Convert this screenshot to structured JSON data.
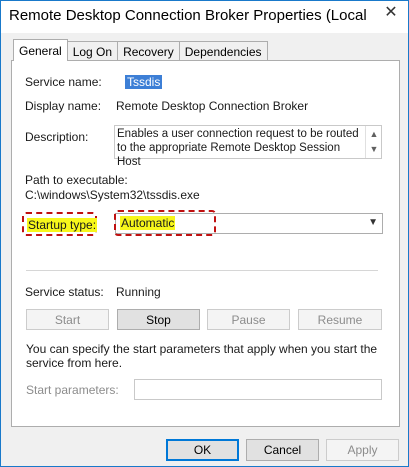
{
  "window": {
    "title": "Remote Desktop Connection Broker Properties (Local Computer)",
    "close_glyph": "✕"
  },
  "tabs": [
    {
      "label": "General",
      "active": true
    },
    {
      "label": "Log On",
      "active": false
    },
    {
      "label": "Recovery",
      "active": false
    },
    {
      "label": "Dependencies",
      "active": false
    }
  ],
  "general": {
    "service_name_label": "Service name:",
    "service_name_value": "Tssdis",
    "display_name_label": "Display name:",
    "display_name_value": "Remote Desktop Connection Broker",
    "description_label": "Description:",
    "description_value": "Enables a user connection request to be routed to the appropriate Remote Desktop Session Host",
    "path_label": "Path to executable:",
    "path_value": "C:\\windows\\System32\\tssdis.exe",
    "startup_type_label": "Startup type:",
    "startup_type_value": "Automatic",
    "service_status_label": "Service status:",
    "service_status_value": "Running",
    "start_button": "Start",
    "stop_button": "Stop",
    "pause_button": "Pause",
    "resume_button": "Resume",
    "params_help": "You can specify the start parameters that apply when you start the service from here.",
    "start_params_label": "Start parameters:",
    "start_params_value": ""
  },
  "footer": {
    "ok": "OK",
    "cancel": "Cancel",
    "apply": "Apply"
  },
  "colors": {
    "highlight": "#f7f71b",
    "annotation": "#c01010",
    "selection": "#3d7fd6"
  }
}
